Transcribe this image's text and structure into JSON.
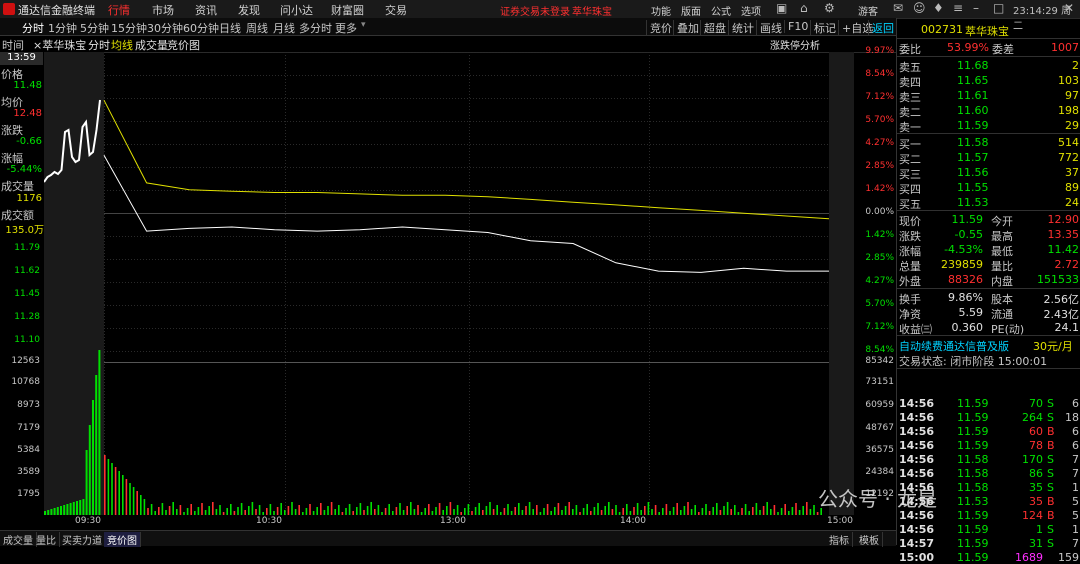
{
  "app": {
    "name": "通达信金融终端",
    "menus": [
      "行情",
      "市场",
      "资讯",
      "发现",
      "问小达",
      "财富圈",
      "交易"
    ],
    "active_menu": "行情",
    "warning": "证券交易未登录",
    "stock_link": "萃华珠宝",
    "right_menus": [
      "功能",
      "版面",
      "公式",
      "选项"
    ],
    "clock": "23:14:29 周二"
  },
  "periods": [
    "分时",
    "1分钟",
    "5分钟",
    "15分钟",
    "30分钟",
    "60分钟",
    "日线",
    "周线",
    "月线",
    "多分时",
    "更多"
  ],
  "selected_period": "分时",
  "tools": [
    "竞价",
    "叠加",
    "超盘",
    "统计",
    "画线",
    "F10",
    "标记",
    "+自选",
    "返回"
  ],
  "chart_header": {
    "time_label": "时间",
    "stock": "×萃华珠宝",
    "mode": "分时",
    "avg_line": "均线",
    "vol": "成交量",
    "auction": "竞价图",
    "limit_analysis": "涨跌停分析"
  },
  "cursor_info": {
    "time": "13:59",
    "price_label": "价格",
    "price": "11.48",
    "avg_label": "均价",
    "avg": "12.48",
    "change_label": "涨跌",
    "change": "-0.66",
    "pct_label": "涨幅",
    "pct": "-5.44%",
    "vol_label": "成交量",
    "vol": "1176",
    "amount_label": "成交额",
    "amount": "135.0万"
  },
  "price_axis_left": [
    "11.79",
    "11.62",
    "11.45",
    "11.28",
    "11.10"
  ],
  "pct_axis_right": [
    "9.97%",
    "8.54%",
    "7.12%",
    "5.70%",
    "4.27%",
    "2.85%",
    "1.42%",
    "0.00%",
    "1.42%",
    "2.85%",
    "4.27%",
    "5.70%",
    "7.12%",
    "8.54%"
  ],
  "vol_axis_left": [
    "12563",
    "10768",
    "8973",
    "7179",
    "5384",
    "3589",
    "1795"
  ],
  "vol_axis_right": [
    "85342",
    "73151",
    "60959",
    "48767",
    "36575",
    "24384",
    "12192"
  ],
  "time_axis": [
    "09:30",
    "10:30",
    "13:00",
    "14:00",
    "15:00"
  ],
  "chart_data": {
    "type": "line",
    "x": [
      "09:30",
      "09:45",
      "10:00",
      "10:15",
      "10:30",
      "10:45",
      "11:00",
      "11:15",
      "11:30",
      "13:00",
      "13:15",
      "13:30",
      "13:45",
      "14:00",
      "14:15",
      "14:30",
      "14:45",
      "15:00"
    ],
    "series": [
      {
        "name": "价格",
        "values": [
          12.6,
          12.05,
          12.07,
          12.08,
          12.06,
          12.05,
          12.06,
          12.08,
          12.06,
          12.04,
          11.98,
          11.96,
          11.82,
          11.76,
          11.75,
          11.78,
          11.76,
          11.76
        ]
      },
      {
        "name": "均价",
        "values": [
          13.0,
          12.4,
          12.35,
          12.34,
          12.33,
          12.33,
          12.32,
          12.31,
          12.31,
          12.3,
          12.28,
          12.26,
          12.24,
          12.22,
          12.2,
          12.18,
          12.16,
          12.14
        ]
      }
    ],
    "ylim": [
      11.1,
      13.35
    ]
  },
  "quote": {
    "code": "002731",
    "name": "萃华珠宝",
    "wb_label": "委比",
    "wb_pct": "53.99%",
    "wc_label": "委差",
    "wc": "1007",
    "sells": [
      {
        "label": "卖五",
        "price": "11.68",
        "vol": "2"
      },
      {
        "label": "卖四",
        "price": "11.65",
        "vol": "103"
      },
      {
        "label": "卖三",
        "price": "11.61",
        "vol": "97"
      },
      {
        "label": "卖二",
        "price": "11.60",
        "vol": "198"
      },
      {
        "label": "卖一",
        "price": "11.59",
        "vol": "29"
      }
    ],
    "buys": [
      {
        "label": "买一",
        "price": "11.58",
        "vol": "514"
      },
      {
        "label": "买二",
        "price": "11.57",
        "vol": "772"
      },
      {
        "label": "买三",
        "price": "11.56",
        "vol": "37"
      },
      {
        "label": "买四",
        "price": "11.55",
        "vol": "89"
      },
      {
        "label": "买五",
        "price": "11.53",
        "vol": "24"
      }
    ],
    "stats": [
      {
        "l1": "现价",
        "v1": "11.59",
        "l2": "今开",
        "v2": "12.90"
      },
      {
        "l1": "涨跌",
        "v1": "-0.55",
        "l2": "最高",
        "v2": "13.35"
      },
      {
        "l1": "涨幅",
        "v1": "-4.53%",
        "l2": "最低",
        "v2": "11.42"
      },
      {
        "l1": "总量",
        "v1": "239859",
        "l2": "量比",
        "v2": "2.72"
      },
      {
        "l1": "外盘",
        "v1": "88326",
        "l2": "内盘",
        "v2": "151533"
      }
    ],
    "stats2": [
      {
        "l1": "换手",
        "v1": "9.86%",
        "l2": "股本",
        "v2": "2.56亿"
      },
      {
        "l1": "净资",
        "v1": "5.59",
        "l2": "流通",
        "v2": "2.43亿"
      },
      {
        "l1": "收益㈢",
        "v1": "0.360",
        "l2": "PE(动)",
        "v2": "24.1"
      }
    ],
    "promo": "自动续费通达信普及版",
    "promo_price": "30元/月",
    "trade_state": "交易状态: 闭市阶段 15:00:01"
  },
  "ticks": [
    {
      "t": "14:56",
      "p": "11.59",
      "v": "70",
      "s": "S",
      "n": "6"
    },
    {
      "t": "14:56",
      "p": "11.59",
      "v": "264",
      "s": "S",
      "n": "18"
    },
    {
      "t": "14:56",
      "p": "11.59",
      "v": "60",
      "s": "B",
      "n": "6"
    },
    {
      "t": "14:56",
      "p": "11.59",
      "v": "78",
      "s": "B",
      "n": "6"
    },
    {
      "t": "14:56",
      "p": "11.58",
      "v": "170",
      "s": "S",
      "n": "7"
    },
    {
      "t": "14:56",
      "p": "11.58",
      "v": "86",
      "s": "S",
      "n": "7"
    },
    {
      "t": "14:56",
      "p": "11.58",
      "v": "35",
      "s": "S",
      "n": "1"
    },
    {
      "t": "14:56",
      "p": "11.53",
      "v": "35",
      "s": "B",
      "n": "5"
    },
    {
      "t": "14:56",
      "p": "11.59",
      "v": "124",
      "s": "B",
      "n": "5"
    },
    {
      "t": "14:56",
      "p": "11.59",
      "v": "1",
      "s": "S",
      "n": "1"
    },
    {
      "t": "14:57",
      "p": "11.59",
      "v": "31",
      "s": "S",
      "n": "7"
    },
    {
      "t": "15:00",
      "p": "11.59",
      "v": "1689",
      "s": "",
      "n": "159"
    }
  ],
  "bottom_tabs": [
    "成交量",
    "量比",
    "买卖力道",
    "竞价图"
  ],
  "bottom_right": [
    "指标",
    "模板"
  ],
  "watermark": "公众号 · 龙是",
  "colors": {
    "up": "#ff3030",
    "down": "#00e000",
    "avg": "#e0e000",
    "accent": "#00d2ff"
  }
}
